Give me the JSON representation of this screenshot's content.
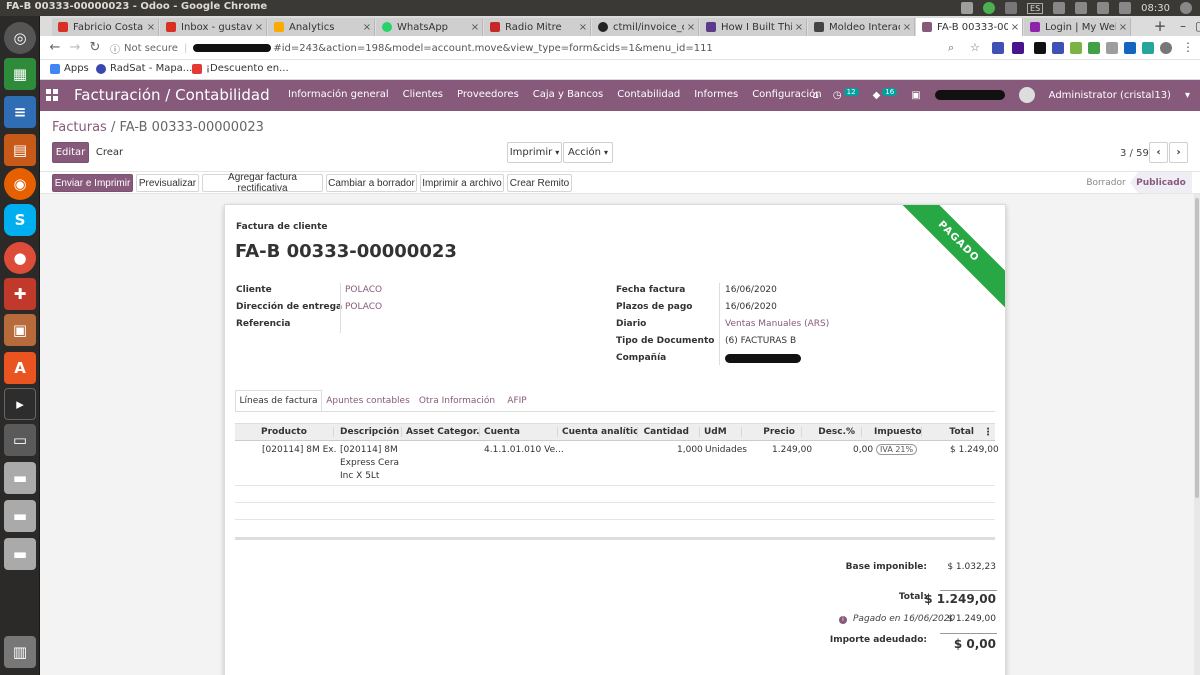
{
  "window_title": "FA-B 00333-00000023 - Odoo - Google Chrome",
  "tray": {
    "clock": "08:30",
    "lang": "ES"
  },
  "tabs": [
    {
      "title": "Fabricio Costa s",
      "favicon_color": "#d93025"
    },
    {
      "title": "Inbox - gustavo",
      "favicon_color": "#d93025"
    },
    {
      "title": "Analytics",
      "favicon_color": "#f9ab00"
    },
    {
      "title": "WhatsApp",
      "favicon_color": "#25d366"
    },
    {
      "title": "Radio Mitre",
      "favicon_color": "#c62828"
    },
    {
      "title": "ctmil/invoice_c",
      "favicon_color": "#222222"
    },
    {
      "title": "How I Built This",
      "favicon_color": "#5b3a8c"
    },
    {
      "title": "Moldeo Interact",
      "favicon_color": "#444444"
    },
    {
      "title": "FA-B 00333-0000",
      "favicon_color": "#875a7b"
    },
    {
      "title": "Login | My Webs",
      "favicon_color": "#8e24aa"
    }
  ],
  "address": {
    "security": "Not secure",
    "url_suffix": "#id=243&action=198&model=account.move&view_type=form&cids=1&menu_id=111"
  },
  "bookmarks": [
    {
      "label": "Apps",
      "icon": "apps-grid-icon",
      "color": "#4285f4"
    },
    {
      "label": "RadSat - Mapa...",
      "icon": "globe-icon",
      "color": "#3949ab"
    },
    {
      "label": "¡Descuento en...",
      "icon": "crown-icon",
      "color": "#e53935"
    }
  ],
  "odoo": {
    "app_title": "Facturación / Contabilidad",
    "menu": [
      "Información general",
      "Clientes",
      "Proveedores",
      "Caja y Bancos",
      "Contabilidad",
      "Informes",
      "Configuración"
    ],
    "activity_count": "12",
    "message_count": "16",
    "user": "Administrator (cristal13)",
    "brand_color": "#875a7b"
  },
  "breadcrumb": {
    "parent": "Facturas",
    "sep": "/",
    "current": "FA-B 00333-00000023"
  },
  "buttons": {
    "edit": "Editar",
    "create": "Crear",
    "print": "Imprimir",
    "action": "Acción",
    "pager": "3 / 59"
  },
  "status_buttons": [
    "Enviar e Imprimir",
    "Previsualizar",
    "Agregar factura rectificativa",
    "Cambiar a borrador",
    "Imprimir a archivo",
    "Crear Remito"
  ],
  "stages": [
    "Borrador",
    "Publicado"
  ],
  "invoice": {
    "kind": "Factura de cliente",
    "number": "FA-B 00333-00000023",
    "ribbon": "PAGADO",
    "left_fields": [
      {
        "label": "Cliente",
        "value": "POLACO"
      },
      {
        "label": "Dirección de entrega",
        "value": "POLACO"
      },
      {
        "label": "Referencia",
        "value": ""
      }
    ],
    "right_fields": [
      {
        "label": "Fecha factura",
        "value": "16/06/2020"
      },
      {
        "label": "Plazos de pago",
        "value": "16/06/2020"
      },
      {
        "label": "Diario",
        "value": "Ventas Manuales (ARS)"
      },
      {
        "label": "Tipo de Documento",
        "value": "(6) FACTURAS B"
      },
      {
        "label": "Compañía",
        "value": ""
      }
    ],
    "notebook_tabs": [
      "Líneas de factura",
      "Apuntes contables",
      "Otra Información",
      "AFIP"
    ],
    "columns": [
      "Producto",
      "Descripción",
      "Asset Categor...",
      "Cuenta",
      "Cuenta analític...",
      "Cantidad",
      "UdM",
      "Precio",
      "Desc.%",
      "Impuestos",
      "Total"
    ],
    "lines": [
      {
        "product": "[020114] 8M Ex...",
        "description": [
          "[020114] 8M",
          "Express Cera",
          "Inc X 5Lt"
        ],
        "asset": "",
        "account": "4.1.1.01.010 Ve...",
        "analytic": "",
        "qty": "1,000",
        "uom": "Unidades",
        "price": "1.249,00",
        "discount": "0,00",
        "tax": "IVA 21%",
        "total": "$ 1.249,00"
      }
    ],
    "totals": {
      "base_label": "Base imponible:",
      "base_value": "$ 1.032,23",
      "total_label": "Total:",
      "total_value": "$ 1.249,00",
      "paid_label": "Pagado en 16/06/2020",
      "paid_value": "$ 1.249,00",
      "due_label": "Importe adeudado:",
      "due_value": "$ 0,00"
    }
  }
}
